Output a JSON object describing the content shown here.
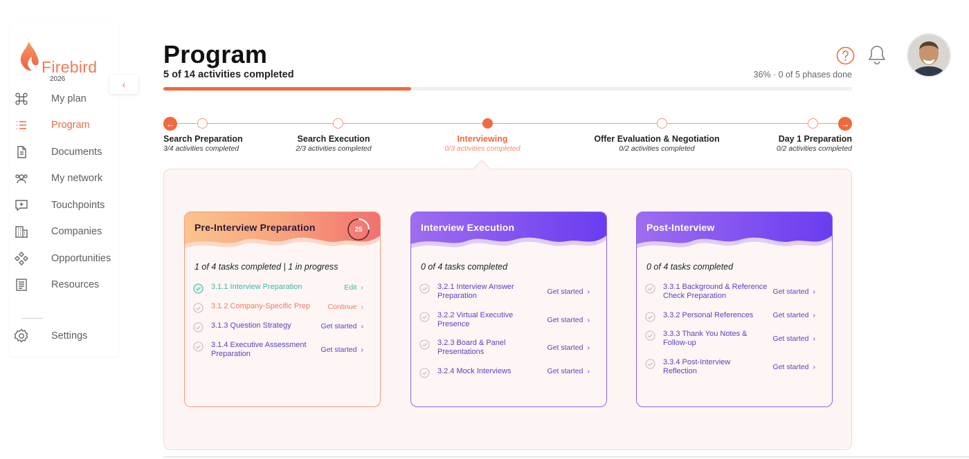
{
  "brand": {
    "name": "Firebird",
    "year": "2026",
    "accent": "#f06a3e"
  },
  "sidebar": {
    "items": [
      {
        "label": "My plan",
        "icon": "command-icon"
      },
      {
        "label": "Program",
        "icon": "list-icon",
        "active": true
      },
      {
        "label": "Documents",
        "icon": "document-icon"
      },
      {
        "label": "My network",
        "icon": "people-icon"
      },
      {
        "label": "Touchpoints",
        "icon": "chat-plus-icon"
      },
      {
        "label": "Companies",
        "icon": "building-icon"
      },
      {
        "label": "Opportunities",
        "icon": "diamond-icon"
      },
      {
        "label": "Resources",
        "icon": "notes-icon"
      }
    ],
    "settings": {
      "label": "Settings",
      "icon": "gear-icon"
    }
  },
  "header": {
    "title": "Program",
    "subtitle": "5 of 14 activities completed",
    "progress_text": "36% · 0 of 5 phases done",
    "progress_percent": 36
  },
  "timeline": {
    "phases": [
      {
        "name": "Search Preparation",
        "status": "3/4 activities completed"
      },
      {
        "name": "Search Execution",
        "status": "2/3 activities completed"
      },
      {
        "name": "Interviewing",
        "status": "0/3 activities completed",
        "active": true
      },
      {
        "name": "Offer Evaluation & Negotiation",
        "status": "0/2 activities completed"
      },
      {
        "name": "Day 1 Preparation",
        "status": "0/2 activities completed"
      }
    ]
  },
  "cards": [
    {
      "title": "Pre-Interview Preparation",
      "badge": "25",
      "badge_progress": 0.25,
      "summary": "1 of 4 tasks completed | 1 in progress",
      "tasks": [
        {
          "name": "3.1.1 Interview Preparation",
          "action": "Edit",
          "state": "done"
        },
        {
          "name": "3.1.2 Company-Specific Prep",
          "action": "Continue",
          "state": "in-progress"
        },
        {
          "name": "3.1.3 Question Strategy",
          "action": "Get started",
          "state": "todo"
        },
        {
          "name": "3.1.4 Executive Assessment Preparation",
          "action": "Get started",
          "state": "todo"
        }
      ]
    },
    {
      "title": "Interview Execution",
      "summary": "0 of 4 tasks completed",
      "tasks": [
        {
          "name": "3.2.1 Interview Answer Preparation",
          "action": "Get started",
          "state": "todo"
        },
        {
          "name": "3.2.2 Virtual Executive Presence",
          "action": "Get started",
          "state": "todo"
        },
        {
          "name": "3.2.3 Board & Panel Presentations",
          "action": "Get started",
          "state": "todo"
        },
        {
          "name": "3.2.4 Mock Interviews",
          "action": "Get started",
          "state": "todo"
        }
      ]
    },
    {
      "title": "Post-Interview",
      "summary": "0 of 4 tasks completed",
      "tasks": [
        {
          "name": "3.3.1 Background & Reference Check Preparation",
          "action": "Get started",
          "state": "todo"
        },
        {
          "name": "3.3.2 Personal References",
          "action": "Get started",
          "state": "todo"
        },
        {
          "name": "3.3.3 Thank You Notes & Follow-up",
          "action": "Get started",
          "state": "todo"
        },
        {
          "name": "3.3.4 Post-Interview Reflection",
          "action": "Get started",
          "state": "todo"
        }
      ]
    }
  ]
}
